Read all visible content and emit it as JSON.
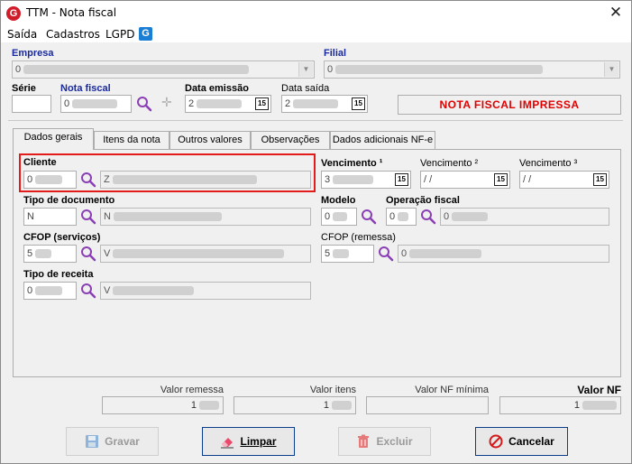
{
  "window": {
    "title": "TTM - Nota fiscal",
    "logo_letter": "G",
    "close_glyph": "✕"
  },
  "menu": {
    "items": [
      "Saída",
      "Cadastros",
      "LGPD"
    ],
    "gen_logo_letter": "G"
  },
  "header": {
    "empresa_label": "Empresa",
    "empresa_value": "0",
    "filial_label": "Filial",
    "filial_value": "0",
    "serie_label": "Série",
    "serie_value": "",
    "nota_label": "Nota fiscal",
    "nota_value": "0",
    "data_emissao_label": "Data emissão",
    "data_emissao_value": "2",
    "data_saida_label": "Data saída",
    "data_saida_value": "2",
    "calendar_glyph": "15",
    "status": "NOTA FISCAL IMPRESSA"
  },
  "tabs": [
    "Dados gerais",
    "Itens da nota",
    "Outros valores",
    "Observações",
    "Dados adicionais NF-e"
  ],
  "form": {
    "cliente_label": "Cliente",
    "cliente_code": "0",
    "cliente_name": "Z",
    "vencimento1_label": "Vencimento ¹",
    "vencimento1_value": "3",
    "vencimento2_label": "Vencimento ²",
    "vencimento2_value": " / /",
    "vencimento3_label": "Vencimento ³",
    "vencimento3_value": " / /",
    "tipo_doc_label": "Tipo de documento",
    "tipo_doc_code": "N",
    "tipo_doc_name": "N",
    "modelo_label": "Modelo",
    "modelo_value": "0",
    "operacao_label": "Operação fiscal",
    "operacao_code": "0",
    "operacao_name": "0",
    "cfop_serv_label": "CFOP (serviços)",
    "cfop_serv_code": "5",
    "cfop_serv_name": "V",
    "cfop_rem_label": "CFOP (remessa)",
    "cfop_rem_code": "5",
    "cfop_rem_name": "0",
    "tipo_receita_label": "Tipo de receita",
    "tipo_receita_code": "0",
    "tipo_receita_name": "V"
  },
  "totals": {
    "remessa_label": "Valor remessa",
    "remessa_value": "1",
    "itens_label": "Valor itens",
    "itens_value": "1",
    "nf_min_label": "Valor NF mínima",
    "nf_min_value": "",
    "nf_label": "Valor NF",
    "nf_value": "1"
  },
  "buttons": {
    "gravar": "Gravar",
    "limpar": "Limpar",
    "excluir": "Excluir",
    "cancelar": "Cancelar"
  },
  "colors": {
    "status_red": "#e00000",
    "highlight_red": "#e31b1b",
    "label_blue": "#1a2a9c",
    "search_purple": "#8a3fb5"
  }
}
